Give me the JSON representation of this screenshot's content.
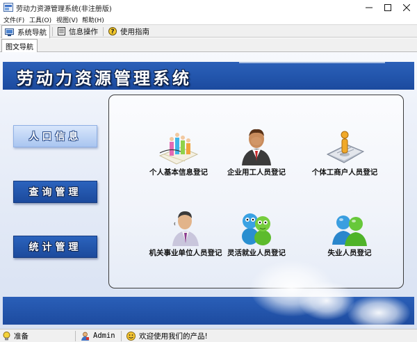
{
  "window": {
    "title": "劳动力资源管理系统(非注册版)",
    "controls": {
      "minimize": "─",
      "maximize": "☐",
      "close": "✕"
    }
  },
  "menu": [
    "文件(F)",
    "工具(O)",
    "视图(V)",
    "帮助(H)"
  ],
  "nav": {
    "items": [
      {
        "label": "系统导航",
        "icon": "monitor-icon",
        "active": true
      },
      {
        "label": "信息操作",
        "icon": "document-icon",
        "active": false
      },
      {
        "label": "使用指南",
        "icon": "help-icon",
        "active": false
      }
    ]
  },
  "subtab": {
    "label": "图文导航"
  },
  "banner": {
    "title": "劳动力资源管理系统"
  },
  "sidebar": {
    "buttons": [
      {
        "label": "人口信息",
        "style": "light"
      },
      {
        "label": "查询管理",
        "style": "dark"
      },
      {
        "label": "统计管理",
        "style": "dark"
      }
    ]
  },
  "tiles": [
    {
      "label": "个人基本信息登记",
      "icon": "people-chart-icon"
    },
    {
      "label": "企业用工人员登记",
      "icon": "businessman-icon"
    },
    {
      "label": "个体工商户人员登记",
      "icon": "person-on-document-icon"
    },
    {
      "label": "机关事业单位人员登记",
      "icon": "office-worker-icon"
    },
    {
      "label": "灵活就业人员登记",
      "icon": "two-mascots-icon"
    },
    {
      "label": "失业人员登记",
      "icon": "two-users-icon"
    }
  ],
  "status": {
    "ready": "准备",
    "user": "Admin",
    "message": "欢迎使用我们的产品!"
  },
  "colors": {
    "band_blue": "#2356ad",
    "light_button": "#bcd3f5",
    "dark_button": "#2356ad"
  }
}
